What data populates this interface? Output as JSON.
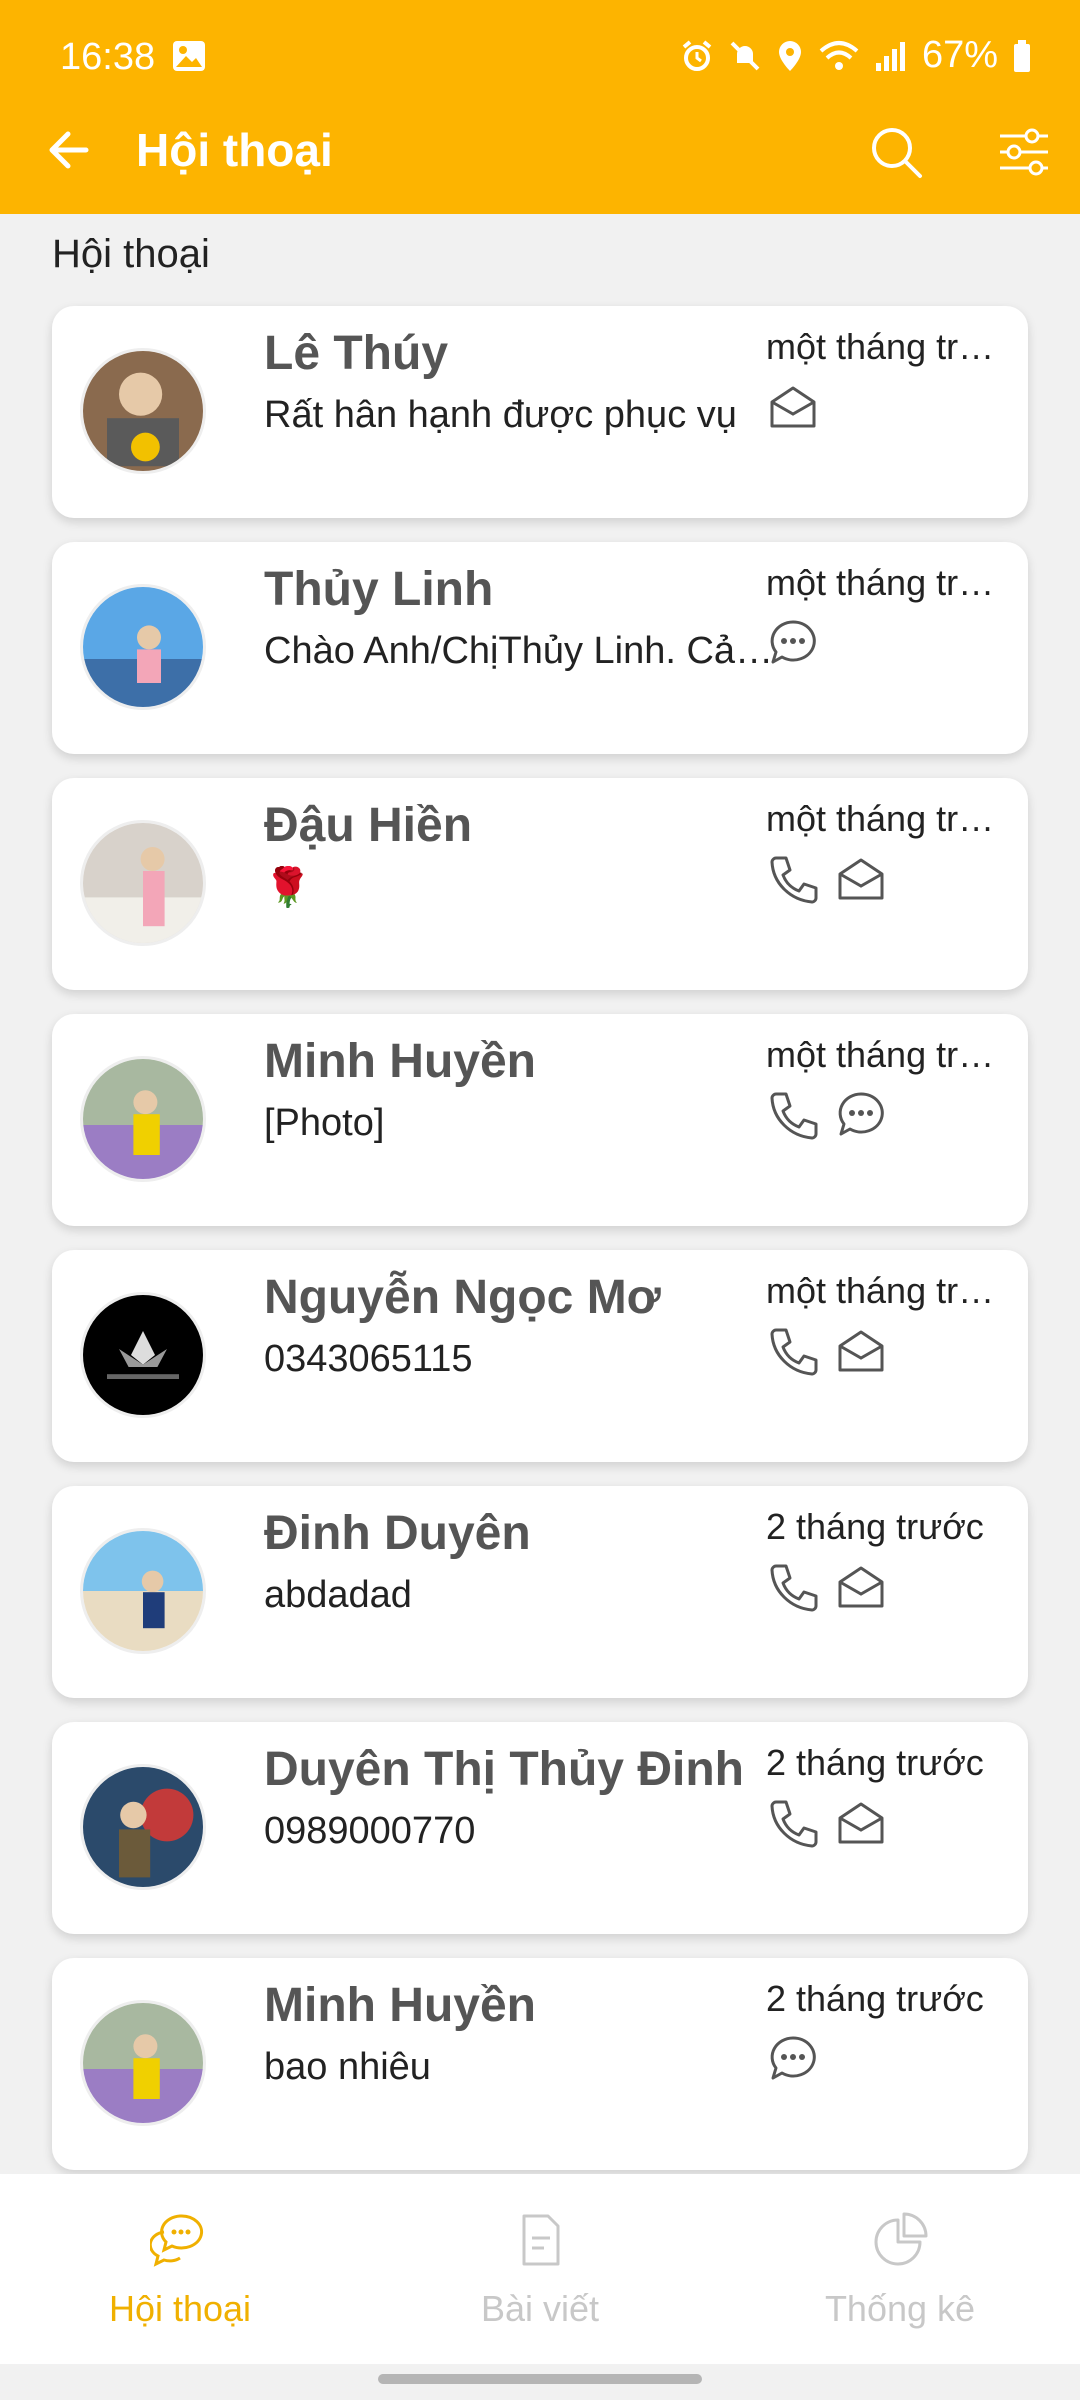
{
  "status_bar": {
    "time": "16:38",
    "battery": "67%"
  },
  "toolbar": {
    "title": "Hội thoại"
  },
  "section_label": "Hội thoại",
  "conversations": [
    {
      "name": "Lê Thúy",
      "preview": "Rất hân hạnh được phục vụ",
      "time": "một tháng trước",
      "channels": [
        "mail"
      ]
    },
    {
      "name": "Thủy Linh",
      "preview": "Chào Anh/ChịThủy Linh. Cảm ơn",
      "time": "một tháng trước",
      "channels": [
        "chat"
      ]
    },
    {
      "name": "Đậu Hiền",
      "preview": "🌹",
      "time": "một tháng trước",
      "channels": [
        "phone",
        "mail"
      ]
    },
    {
      "name": "Minh Huyền",
      "preview": "[Photo]",
      "time": "một tháng trước",
      "channels": [
        "phone",
        "chat"
      ]
    },
    {
      "name": "Nguyễn Ngọc Mơ",
      "preview": "0343065115",
      "time": "một tháng trước",
      "channels": [
        "phone",
        "mail"
      ]
    },
    {
      "name": "Đinh Duyên",
      "preview": "abdadad",
      "time": "2 tháng trước",
      "channels": [
        "phone",
        "mail"
      ]
    },
    {
      "name": "Duyên Thị Thủy Đinh",
      "preview": "0989000770",
      "time": "2 tháng trước",
      "channels": [
        "phone",
        "mail"
      ]
    },
    {
      "name": "Minh Huyền",
      "preview": "bao nhiêu",
      "time": "2 tháng trước",
      "channels": [
        "chat"
      ]
    }
  ],
  "bottom_nav": [
    {
      "label": "Hội thoại",
      "icon": "chat-bubbles-icon",
      "active": true
    },
    {
      "label": "Bài viết",
      "icon": "document-icon",
      "active": false
    },
    {
      "label": "Thống kê",
      "icon": "pie-chart-icon",
      "active": false
    }
  ],
  "colors": {
    "accent": "#fdb400",
    "active_nav": "#f0b000",
    "inactive_nav": "#c8c8c8"
  }
}
